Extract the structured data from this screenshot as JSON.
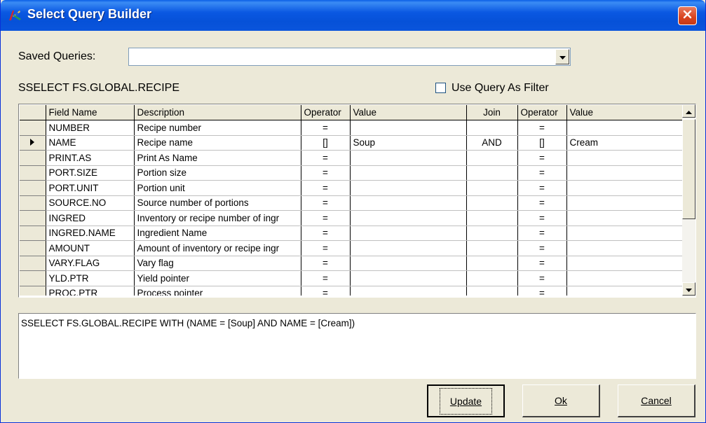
{
  "window": {
    "title": "Select Query Builder"
  },
  "saved_queries": {
    "label": "Saved Queries:",
    "value": ""
  },
  "base_statement": "SSELECT FS.GLOBAL.RECIPE",
  "use_query_as_filter": {
    "label": "Use Query As Filter",
    "checked": false
  },
  "grid": {
    "columns": [
      "Field Name",
      "Description",
      "Operator",
      "Value",
      "Join",
      "Operator",
      "Value"
    ],
    "rows": [
      [
        "NUMBER",
        "Recipe number",
        "=",
        "",
        "",
        "=",
        ""
      ],
      [
        "NAME",
        "Recipe name",
        "[]",
        "Soup",
        "AND",
        "[]",
        "Cream"
      ],
      [
        "PRINT.AS",
        "Print As Name",
        "=",
        "",
        "",
        "=",
        ""
      ],
      [
        "PORT.SIZE",
        "Portion size",
        "=",
        "",
        "",
        "=",
        ""
      ],
      [
        "PORT.UNIT",
        "Portion unit",
        "=",
        "",
        "",
        "=",
        ""
      ],
      [
        "SOURCE.NO",
        "Source number of portions",
        "=",
        "",
        "",
        "=",
        ""
      ],
      [
        "INGRED",
        "Inventory or recipe number of ingr",
        "=",
        "",
        "",
        "=",
        ""
      ],
      [
        "INGRED.NAME",
        "Ingredient Name",
        "=",
        "",
        "",
        "=",
        ""
      ],
      [
        "AMOUNT",
        "Amount of inventory or recipe ingr",
        "=",
        "",
        "",
        "=",
        ""
      ],
      [
        "VARY.FLAG",
        "Vary flag",
        "=",
        "",
        "",
        "=",
        ""
      ],
      [
        "YLD.PTR",
        "Yield pointer",
        "=",
        "",
        "",
        "=",
        ""
      ],
      [
        "PROC.PTR",
        "Process pointer",
        "=",
        "",
        "",
        "=",
        ""
      ]
    ],
    "current_row_index": 1
  },
  "query_text": "SSELECT FS.GLOBAL.RECIPE WITH (NAME =  [Soup] AND NAME =  [Cream])",
  "buttons": {
    "update": "Update",
    "ok": "Ok",
    "cancel": "Cancel"
  },
  "colors": {
    "titlebar": "#0a58e2",
    "close": "#d9431f",
    "face": "#ece9d8"
  },
  "icons": {
    "app": "app-logo-icon",
    "close": "close-icon",
    "dropdown": "chevron-down-icon",
    "row_pointer": "row-pointer-icon"
  }
}
